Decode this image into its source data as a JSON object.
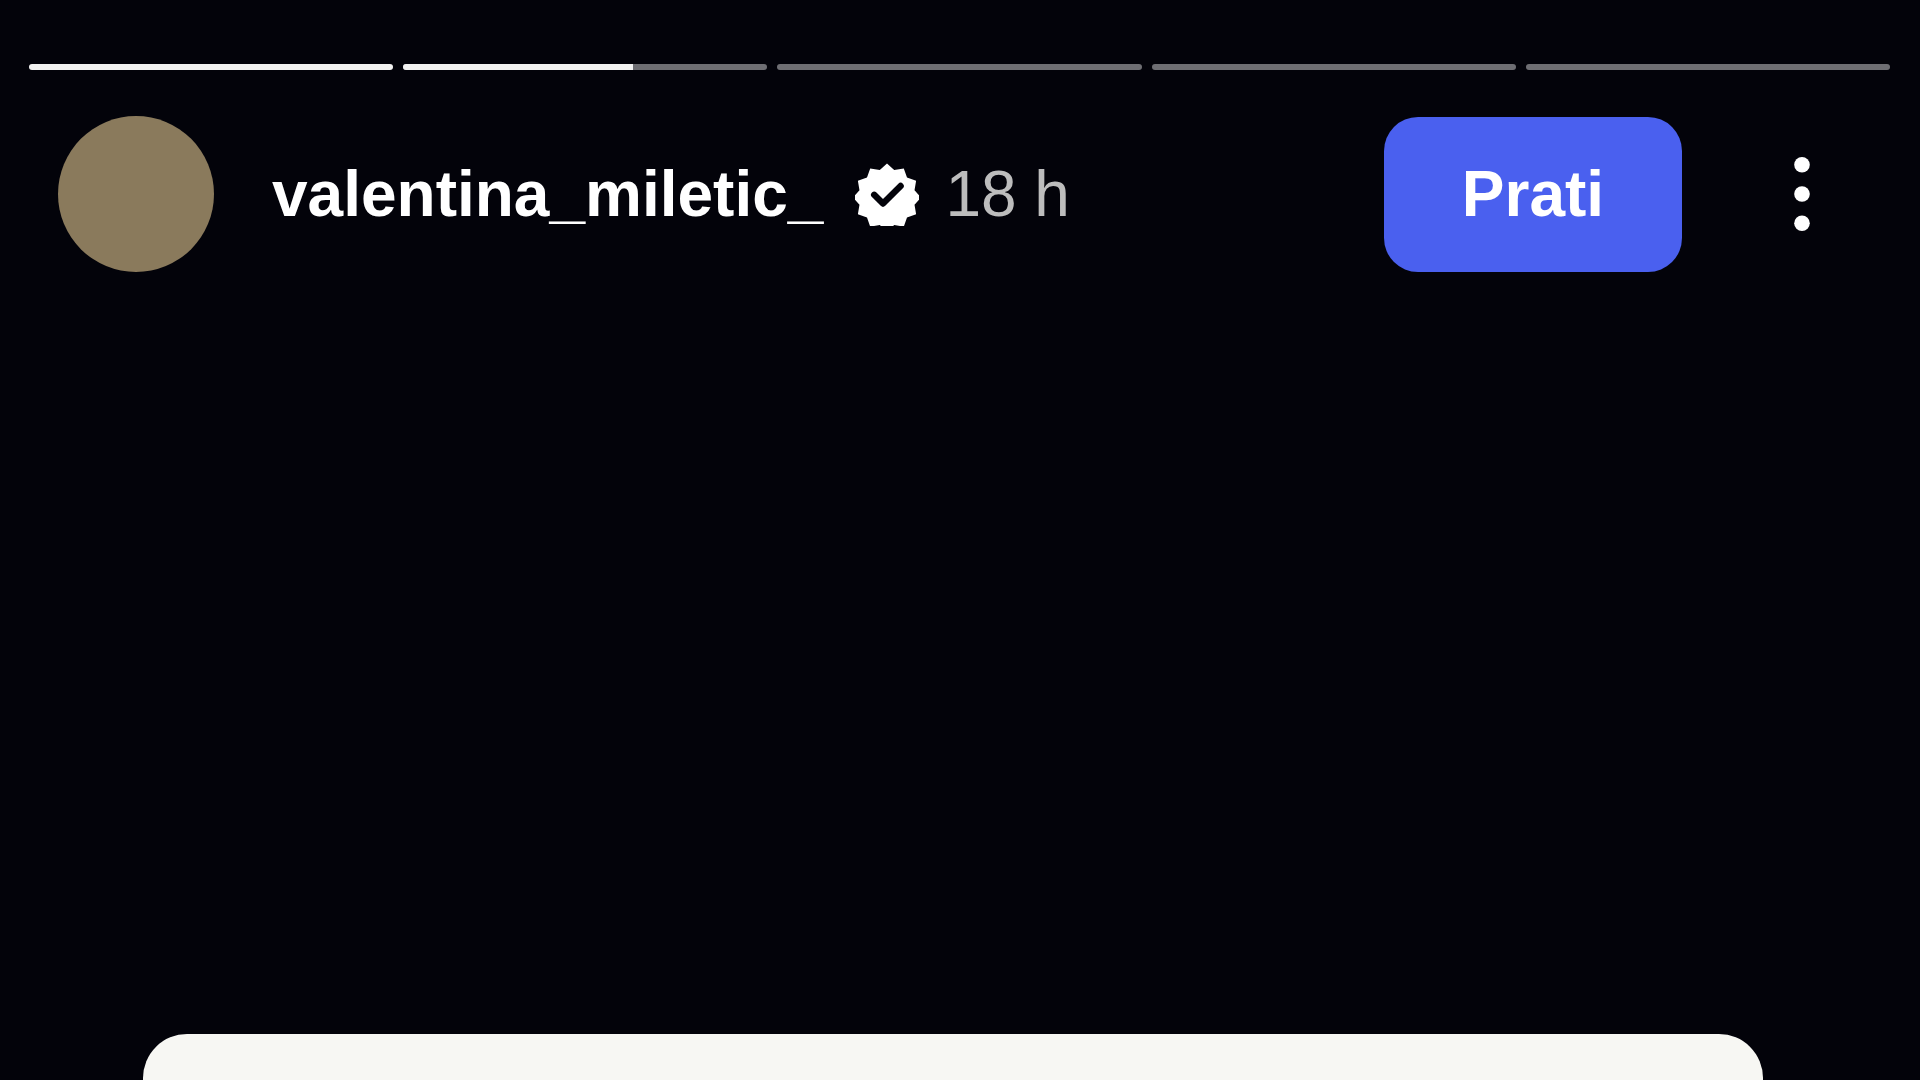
{
  "progress": [
    {
      "level": 1
    },
    {
      "level": 0.63
    },
    {
      "level": 0
    },
    {
      "level": 0
    },
    {
      "level": 0
    }
  ],
  "header": {
    "username": "valentina_miletic_",
    "verified": true,
    "time": "18 h",
    "follow_button": "Prati"
  }
}
